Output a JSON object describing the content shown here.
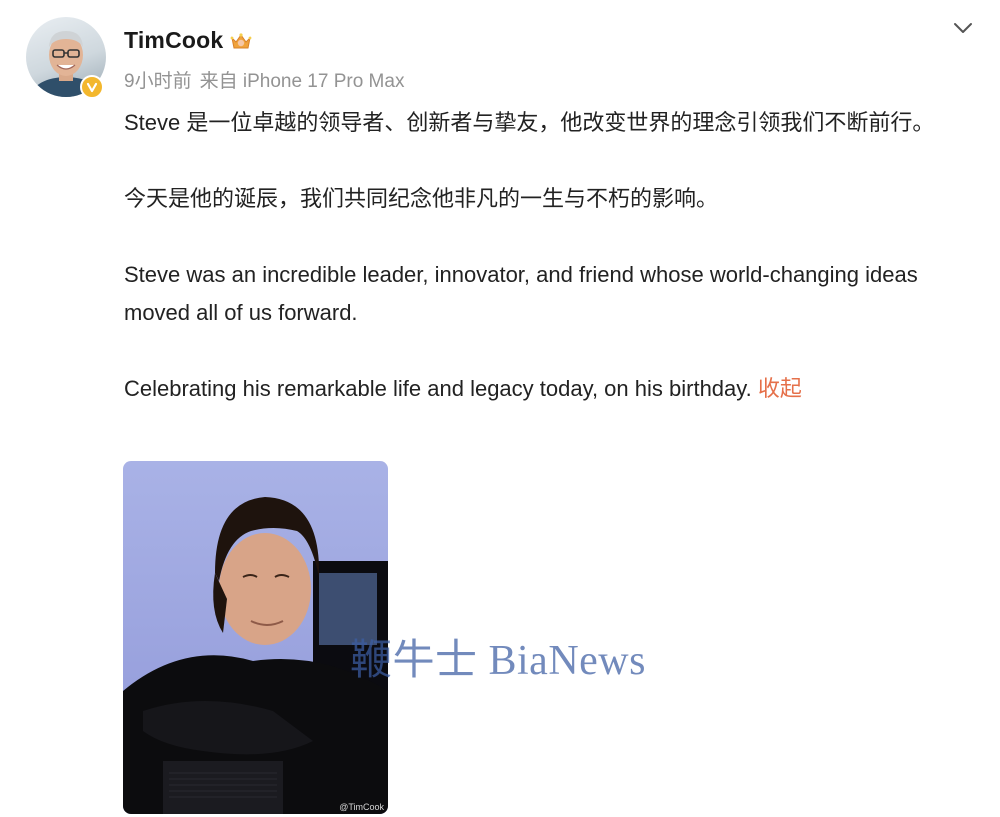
{
  "post": {
    "author": {
      "name": "TimCook",
      "avatar_icon": "avatar-portrait",
      "verified_icon": "verified-badge-icon",
      "member_icon": "crown-icon"
    },
    "meta": {
      "time": "9小时前",
      "source": "来自 iPhone 17 Pro Max"
    },
    "paragraphs": [
      "Steve 是一位卓越的领导者、创新者与挚友，他改变世界的理念引领我们不断前行。",
      "今天是他的诞辰，我们共同纪念他非凡的一生与不朽的影响。",
      "Steve was an incredible leader, innovator, and friend whose world-changing ideas moved all of us forward.",
      "Celebrating his remarkable life and legacy today, on his birthday."
    ],
    "collapse_label": "收起",
    "image": {
      "credit": "@TimCook"
    },
    "watermark": "鞭牛士 BiaNews"
  },
  "colors": {
    "accent_link": "#e5704a",
    "meta_gray": "#939393",
    "verified_gold": "#f3b72d",
    "watermark_blue": "#3c5ea3"
  }
}
